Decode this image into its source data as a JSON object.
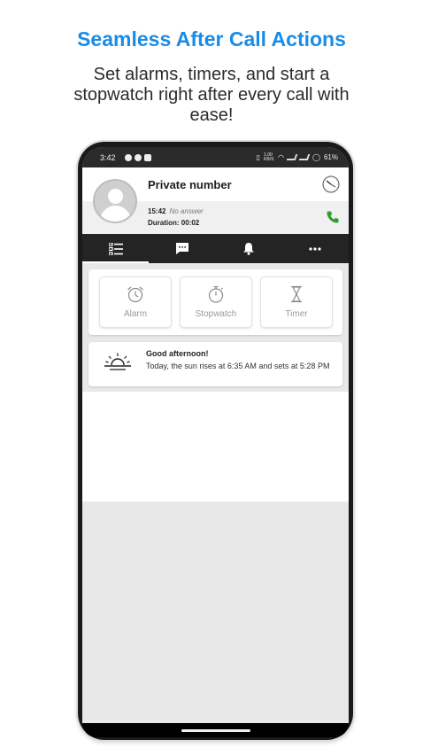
{
  "promo": {
    "headline": "Seamless After Call Actions",
    "subline": "Set alarms, timers, and start a stopwatch right after every call with ease!"
  },
  "status_bar": {
    "time": "3:42",
    "battery": "61%",
    "speed": "1.00 KB/S"
  },
  "call": {
    "caller": "Private number",
    "time": "15:42",
    "status": "No answer",
    "duration": "Duration: 00:02"
  },
  "tabs": [
    {
      "name": "list",
      "icon": "list-icon",
      "active": true
    },
    {
      "name": "messages",
      "icon": "chat-icon",
      "active": false
    },
    {
      "name": "reminders",
      "icon": "bell-icon",
      "active": false
    },
    {
      "name": "more",
      "icon": "more-icon",
      "active": false
    }
  ],
  "actions": [
    {
      "label": "Alarm",
      "icon": "alarm-clock-icon"
    },
    {
      "label": "Stopwatch",
      "icon": "stopwatch-icon"
    },
    {
      "label": "Timer",
      "icon": "hourglass-icon"
    }
  ],
  "weather": {
    "greeting": "Good afternoon!",
    "text": "Today, the sun rises at 6:35 AM and sets at 5:28 PM",
    "icon": "sunset-icon"
  },
  "colors": {
    "headline": "#1a8ce6",
    "call_accent": "#2e9e2e",
    "tab_bar": "#242424"
  }
}
